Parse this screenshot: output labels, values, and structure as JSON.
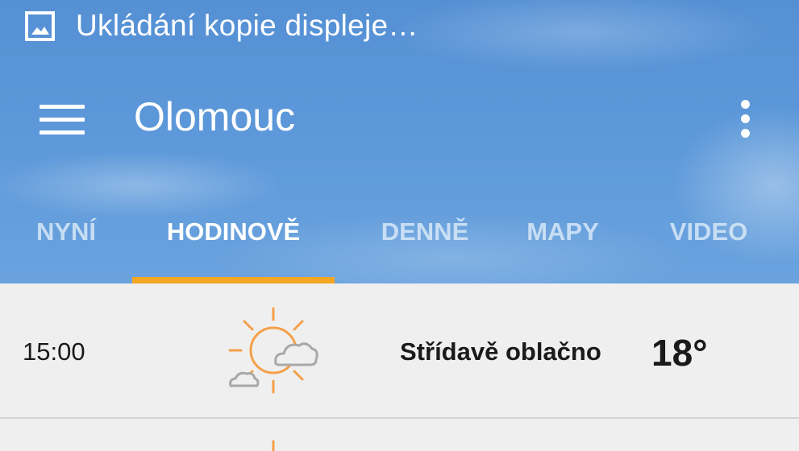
{
  "notification": {
    "text": "Ukládání kopie displeje…",
    "icon": "image-icon"
  },
  "toolbar": {
    "city": "Olomouc",
    "menu_icon": "hamburger-menu-icon",
    "overflow_icon": "more-vert-icon"
  },
  "tabs": [
    {
      "label": "NYNÍ",
      "active": false
    },
    {
      "label": "HODINOVĚ",
      "active": true
    },
    {
      "label": "DENNĚ",
      "active": false
    },
    {
      "label": "MAPY",
      "active": false
    },
    {
      "label": "VIDEO",
      "active": false
    }
  ],
  "colors": {
    "accent": "#f5a623",
    "sun": "#f5a04a",
    "cloud": "#a8a8a8",
    "list_bg": "#efefef"
  },
  "hourly": [
    {
      "time": "15:00",
      "icon": "partly-cloudy-icon",
      "condition": "Střídavě oblačno",
      "temp": "18°"
    },
    {
      "time": "",
      "icon": "sun-icon",
      "condition": "",
      "temp": ""
    }
  ]
}
